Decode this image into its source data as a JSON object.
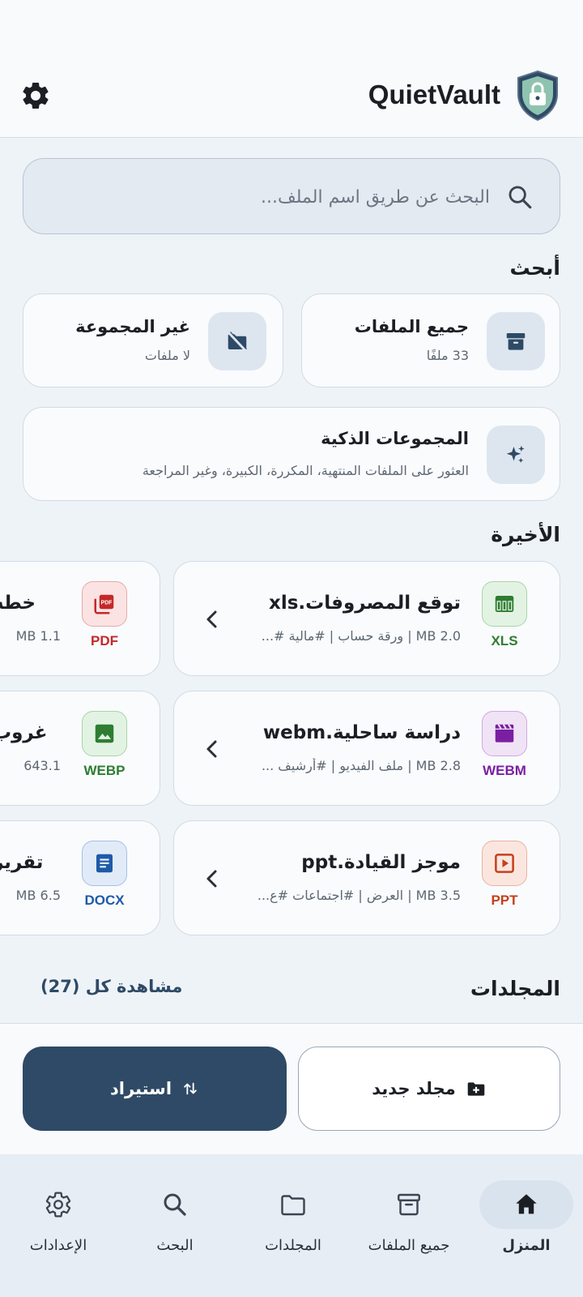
{
  "app": {
    "title": "QuietVault"
  },
  "search": {
    "placeholder": "البحث عن طريق اسم الملف..."
  },
  "browse": {
    "title": "أبحث",
    "all_files": {
      "label": "جميع الملفات",
      "count": "33 ملفًا",
      "icon": "archive-icon"
    },
    "ungrouped": {
      "label": "غير المجموعة",
      "count": "لا ملفات",
      "icon": "folder-off-icon"
    },
    "smart": {
      "label": "المجموعات الذكية",
      "desc": "العثور على الملفات المنتهية، المكررة، الكبيرة، وغير المراجعة",
      "icon": "sparkles-icon"
    }
  },
  "recent": {
    "title": "الأخيرة",
    "items": [
      {
        "name": "توقع المصروفات.xls",
        "meta": "2.0 MB | ورقة حساب | #مالية  #...",
        "tag": "XLS",
        "icon": "table-icon",
        "color": "#2e7d32",
        "bg": "#e3f3e3"
      },
      {
        "name": "دراسة ساحلية.webm",
        "meta": "2.8 MB | ملف الفيديو | #أرشيف  ...",
        "tag": "WEBM",
        "icon": "clapper-icon",
        "color": "#7b1fa2",
        "bg": "#f1e3f6"
      },
      {
        "name": "موجز القيادة.ppt",
        "meta": "3.5 MB | العرض | #اجتماعات  #ع...",
        "tag": "PPT",
        "icon": "slideshow-icon",
        "color": "#c3411b",
        "bg": "#fbe6df"
      }
    ],
    "side_items": [
      {
        "name": "خطة",
        "meta": "1.1 MB",
        "tag": "PDF",
        "icon": "pdf-icon",
        "color": "#c62828",
        "bg": "#fbe3e3"
      },
      {
        "name": "غروب",
        "meta": "643.1",
        "tag": "WEBP",
        "icon": "image-icon",
        "color": "#2e7d32",
        "bg": "#e3f3e3"
      },
      {
        "name": "تقرير",
        "meta": "6.5 MB",
        "tag": "DOCX",
        "icon": "doc-icon",
        "color": "#1e5aa8",
        "bg": "#e1ebf8"
      }
    ]
  },
  "folders": {
    "title": "المجلدات",
    "view_all": "مشاهدة كل (27)"
  },
  "actions": {
    "new_folder": "مجلد جديد",
    "import": "استيراد"
  },
  "nav": [
    {
      "label": "المنزل",
      "icon": "home-icon",
      "active": true
    },
    {
      "label": "جميع الملفات",
      "icon": "archive-icon",
      "active": false
    },
    {
      "label": "المجلدات",
      "icon": "folder-icon",
      "active": false
    },
    {
      "label": "البحث",
      "icon": "search-icon",
      "active": false
    },
    {
      "label": "الإعدادات",
      "icon": "gear-icon",
      "active": false
    }
  ],
  "colors": {
    "primary": "#2e4a66",
    "background": "#eef3f8",
    "card": "#f9fbfd"
  }
}
